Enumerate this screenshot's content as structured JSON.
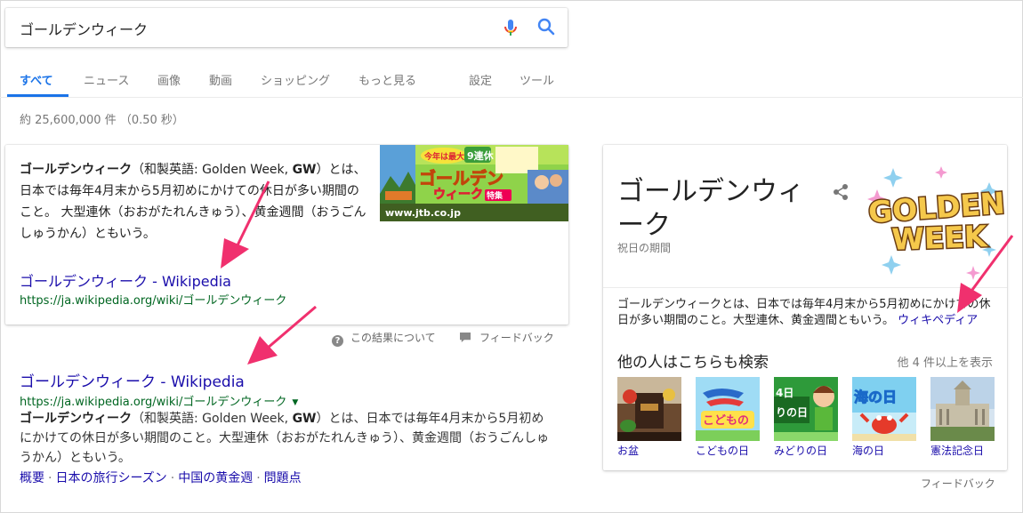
{
  "search": {
    "query": "ゴールデンウィーク"
  },
  "tabs": [
    {
      "label": "すべて",
      "active": true
    },
    {
      "label": "ニュース"
    },
    {
      "label": "画像"
    },
    {
      "label": "動画"
    },
    {
      "label": "ショッピング"
    },
    {
      "label": "もっと見る"
    },
    {
      "label": "設定"
    },
    {
      "label": "ツール"
    }
  ],
  "stats": "約 25,600,000 件 （0.50 秒）",
  "featured_snippet": {
    "term": "ゴールデンウィーク",
    "text_1": "（和製英語: Golden Week, ",
    "term_en": "GW",
    "text_2": "）とは、日本では毎年4月末から5月初めにかけての休日が多い期間のこと。 大型連休（おおがたれんきゅう）、黄金週間（おうごんしゅうかん）ともいう。",
    "image_caption": "www.jtb.co.jp",
    "image_text": {
      "banner_1": "今年は最大",
      "banner_2": "9連休",
      "headline_1": "ゴールデン",
      "headline_2": "ウィーク",
      "headline_3": "特集"
    },
    "link_title": "ゴールデンウィーク - Wikipedia",
    "url": "https://ja.wikipedia.org/wiki/ゴールデンウィーク",
    "about_label": "この結果について",
    "feedback_label": "フィードバック"
  },
  "result": {
    "title": "ゴールデンウィーク - Wikipedia",
    "url": "https://ja.wikipedia.org/wiki/ゴールデンウィーク",
    "desc_term": "ゴールデンウィーク",
    "desc_1": "（和製英語: Golden Week, ",
    "desc_term_en": "GW",
    "desc_2": "）とは、日本では毎年4月末から5月初めにかけての休日が多い期間のこと。大型連休（おおがたれんきゅう）、黄金週間（おうごんしゅうかん）ともいう。",
    "sitelinks": [
      "概要",
      "日本の旅行シーズン",
      "中国の黄金週",
      "問題点"
    ]
  },
  "knowledge_panel": {
    "title": "ゴールデンウィーク",
    "subtitle": "祝日の期間",
    "logo_line_1": "GOLDEN",
    "logo_line_2": "WEEK",
    "description": "ゴールデンウィークとは、日本では毎年4月末から5月初めにかけての休日が多い期間のこと。大型連休、黄金週間ともいう。",
    "source_link": "ウィキペディア",
    "related_title": "他の人はこちらも検索",
    "related_more": "他 4 件以上を表示",
    "related": [
      {
        "label": "お盆"
      },
      {
        "label": "こどもの日",
        "thumb_text": "こどもの"
      },
      {
        "label": "みどりの日",
        "thumb_text_1": "4日",
        "thumb_text_2": "りの日"
      },
      {
        "label": "海の日",
        "thumb_text": "海の日"
      },
      {
        "label": "憲法記念日"
      }
    ],
    "feedback_label": "フィードバック"
  },
  "colors": {
    "link": "#1a0dab",
    "url": "#006621",
    "tab_active": "#1a73e8",
    "arrow": "#f0306e"
  }
}
